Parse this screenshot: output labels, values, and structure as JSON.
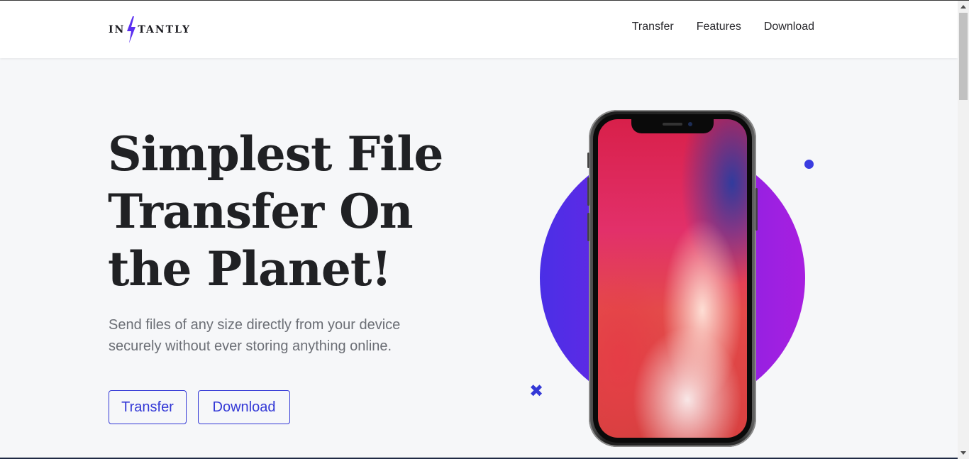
{
  "header": {
    "logo_text_left": "IN",
    "logo_text_right": "TANTLY",
    "nav": [
      {
        "label": "Transfer"
      },
      {
        "label": "Features"
      },
      {
        "label": "Download"
      }
    ]
  },
  "hero": {
    "headline_line1": "Simplest File",
    "headline_line2": "Transfer On",
    "headline_line3": "the Planet!",
    "subtext_line1": "Send files of any size directly from your device",
    "subtext_line2": "securely without ever storing anything online.",
    "buttons": {
      "transfer": "Transfer",
      "download": "Download"
    }
  },
  "decor": {
    "cross_glyph": "✖"
  },
  "colors": {
    "accent": "#3338d6",
    "bolt": "#5b2ff0",
    "circle_start": "#4a2fe6",
    "circle_end": "#a81fe0"
  }
}
